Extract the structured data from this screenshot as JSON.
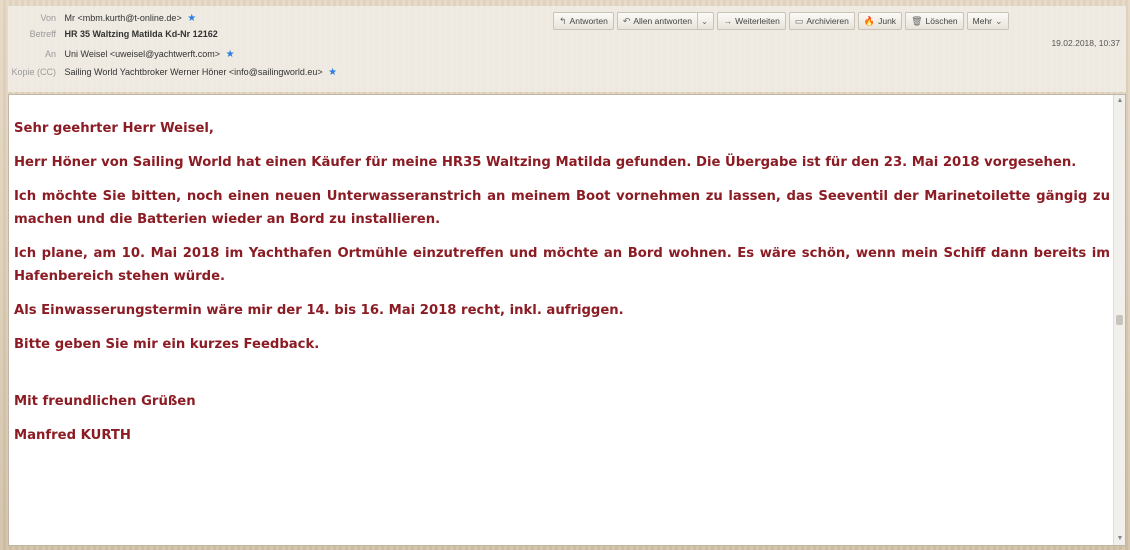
{
  "header": {
    "from_label": "Von",
    "from_value": "Mr <mbm.kurth@t-online.de>",
    "subject_label": "Betreff",
    "subject_value": "HR 35 Waltzing Matilda Kd-Nr 12162",
    "to_label": "An",
    "to_value": "Uni Weisel <uweisel@yachtwerft.com>",
    "cc_label": "Kopie (CC)",
    "cc_value": "Sailing World Yachtbroker Werner Höner <info@sailingworld.eu>",
    "date": "19.02.2018, 10:37"
  },
  "toolbar": {
    "reply": "Antworten",
    "reply_all": "Allen antworten",
    "forward": "Weiterleiten",
    "archive": "Archivieren",
    "junk": "Junk",
    "delete": "Löschen",
    "more": "Mehr"
  },
  "message": {
    "greeting": "Sehr geehrter Herr Weisel,",
    "p1": "Herr Höner von Sailing World hat einen Käufer für meine HR35 Waltzing Matilda gefunden. Die Übergabe ist für den 23. Mai 2018 vorgesehen.",
    "p2": "Ich möchte Sie bitten, noch einen neuen Unterwasseranstrich an meinem Boot vornehmen zu lassen, das Seeventil der Marinetoilette gängig zu machen und die Batterien wieder an Bord zu installieren.",
    "p3": "Ich plane, am 10. Mai 2018 im Yachthafen Ortmühle einzutreffen und möchte an Bord wohnen. Es wäre schön, wenn mein Schiff dann bereits im Hafenbereich stehen würde.",
    "p4": "Als Einwasserungstermin wäre mir der 14. bis 16. Mai 2018 recht, inkl. aufriggen.",
    "p5": "Bitte geben Sie mir ein kurzes Feedback.",
    "closing": "Mit freundlichen Grüßen",
    "signature": "Manfred KURTH"
  },
  "colors": {
    "text": "#8b1c24",
    "star": "#2a7fe0"
  }
}
